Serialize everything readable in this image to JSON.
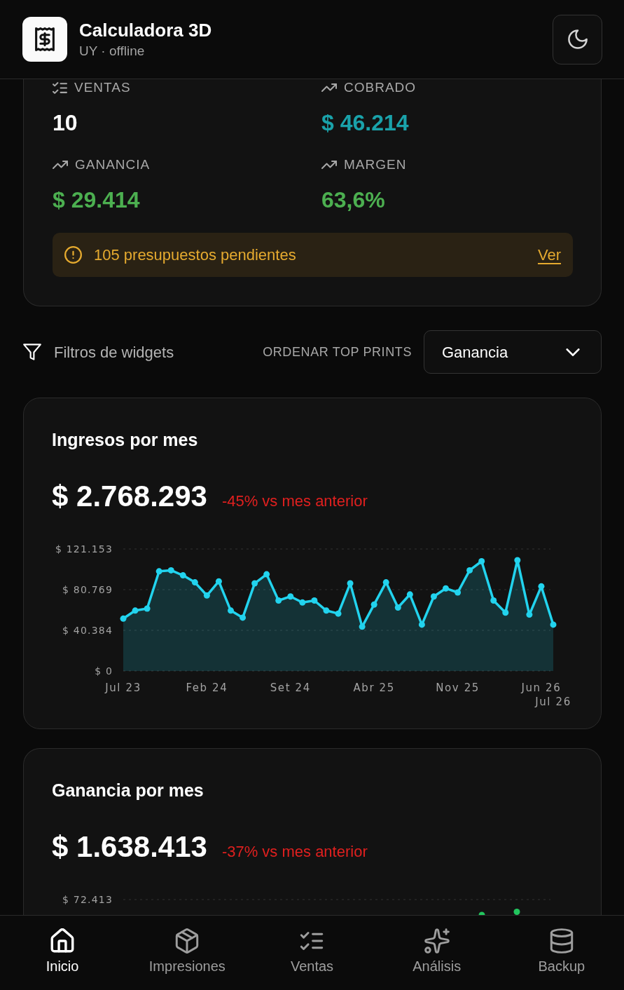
{
  "header": {
    "title": "Calculadora 3D",
    "subtitle": "UY · offline"
  },
  "summary": {
    "stats": [
      {
        "label": "VENTAS",
        "value": "10",
        "color": "#ffffff"
      },
      {
        "label": "COBRADO",
        "value": "$ 46.214",
        "color": "#1aa2aa"
      },
      {
        "label": "GANANCIA",
        "value": "$ 29.414",
        "color": "#4caf50"
      },
      {
        "label": "MARGEN",
        "value": "63,6%",
        "color": "#4caf50"
      }
    ],
    "alert": {
      "text": "105 presupuestos pendientes",
      "link": "Ver"
    }
  },
  "filters": {
    "title": "Filtros de widgets",
    "sort_label": "ORDENAR TOP PRINTS",
    "sort_value": "Ganancia"
  },
  "widgets": [
    {
      "title": "Ingresos por mes",
      "total": "$ 2.768.293",
      "change": "-45% vs mes anterior",
      "chart_data": {
        "type": "area",
        "categories": [
          "Jul 23",
          null,
          null,
          null,
          null,
          null,
          null,
          "Feb 24",
          null,
          null,
          null,
          null,
          null,
          null,
          "Set 24",
          null,
          null,
          null,
          null,
          null,
          null,
          "Abr 25",
          null,
          null,
          null,
          null,
          null,
          null,
          "Nov 25",
          null,
          null,
          null,
          null,
          null,
          null,
          "Jun 26",
          "Jul 26"
        ],
        "values": [
          52000,
          60000,
          62000,
          99000,
          100000,
          95000,
          88000,
          75000,
          89000,
          60000,
          53000,
          87000,
          96000,
          70000,
          74000,
          68000,
          70000,
          60000,
          57000,
          87000,
          44000,
          66000,
          88000,
          63000,
          76000,
          46000,
          74000,
          82000,
          78000,
          100000,
          109000,
          70000,
          58000,
          110000,
          56000,
          84000,
          46000
        ],
        "ylim": [
          0,
          121153
        ],
        "yticks": [
          {
            "value": 0,
            "label": "$ 0"
          },
          {
            "value": 40384,
            "label": "$ 40.384"
          },
          {
            "value": 80769,
            "label": "$ 80.769"
          },
          {
            "value": 121153,
            "label": "$ 121.153"
          }
        ]
      }
    },
    {
      "title": "Ganancia por mes",
      "total": "$ 1.638.413",
      "change": "-37% vs mes anterior",
      "y_tick_label": "$ 72.413"
    }
  ],
  "bottom_nav": [
    {
      "label": "Inicio",
      "selected": true
    },
    {
      "label": "Impresiones",
      "selected": false
    },
    {
      "label": "Ventas",
      "selected": false
    },
    {
      "label": "Análisis",
      "selected": false
    },
    {
      "label": "Backup",
      "selected": false
    }
  ]
}
